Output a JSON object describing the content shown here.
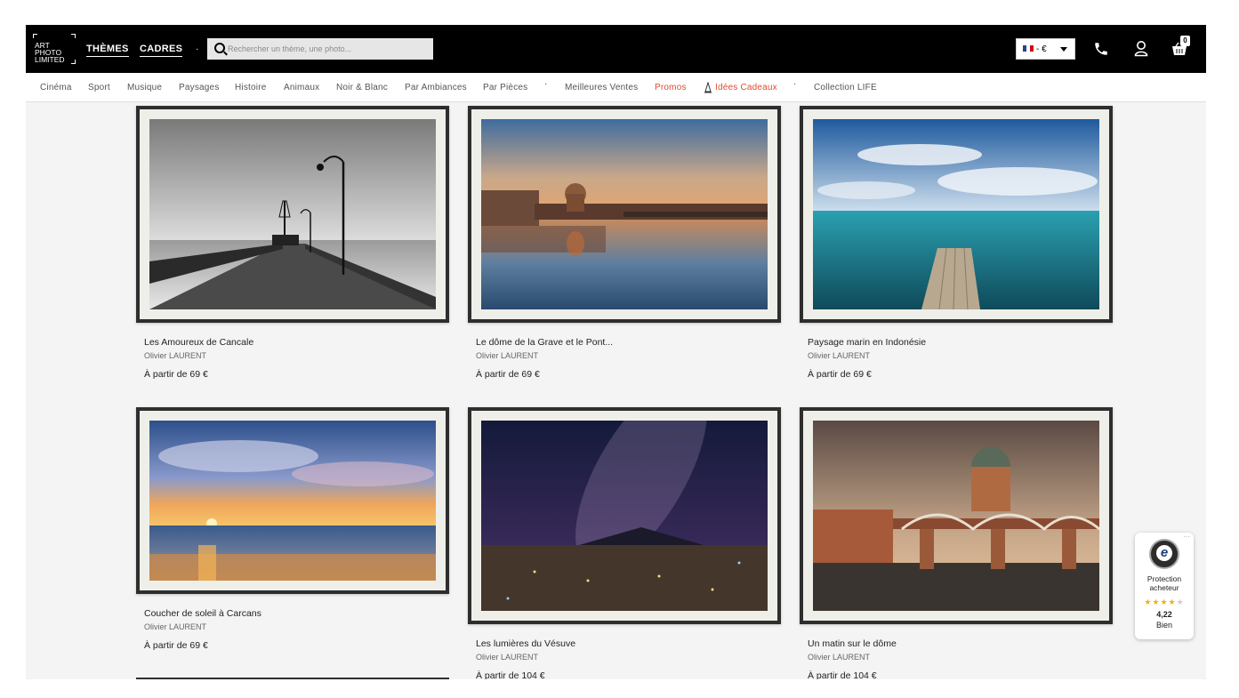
{
  "header": {
    "logo_lines": [
      "ART",
      "PHOTO",
      "LIMITED"
    ],
    "nav": [
      "THÈMES",
      "CADRES"
    ],
    "separator": "·",
    "search_placeholder": "Rechercher un thème, une photo...",
    "currency": "- €",
    "cart_count": "0"
  },
  "categories": {
    "items": [
      "Cinéma",
      "Sport",
      "Musique",
      "Paysages",
      "Histoire",
      "Animaux",
      "Noir & Blanc",
      "Par Ambiances",
      "Par Pièces"
    ],
    "dot": "·",
    "best": "Meilleures Ventes",
    "promo": "Promos",
    "gift": "Idées Cadeaux",
    "life": "Collection LIFE"
  },
  "products": [
    {
      "title": "Les Amoureux de Cancale",
      "author": "Olivier LAURENT",
      "price": "À partir de 69 €"
    },
    {
      "title": "Le dôme de la Grave et le Pont...",
      "author": "Olivier LAURENT",
      "price": "À partir de 69 €"
    },
    {
      "title": "Paysage marin en Indonésie",
      "author": "Olivier LAURENT",
      "price": "À partir de 69 €"
    },
    {
      "title": "Coucher de soleil à Carcans",
      "author": "Olivier LAURENT",
      "price": "À partir de 69 €"
    },
    {
      "title": "Les lumières du Vésuve",
      "author": "Olivier LAURENT",
      "price": "À partir de 104 €"
    },
    {
      "title": "Un matin sur le dôme",
      "author": "Olivier LAURENT",
      "price": "À partir de 104 €"
    }
  ],
  "trust": {
    "seal_letter": "e",
    "line1": "Protection",
    "line2": "acheteur",
    "rating": "4,22",
    "label": "Bien",
    "more": "···",
    "stars_filled": 4,
    "stars_total": 5
  },
  "icons": [
    "logo-mark",
    "search-icon",
    "flag-icon",
    "caret-down-icon",
    "phone-icon",
    "user-icon",
    "cart-icon",
    "gift-icon"
  ]
}
